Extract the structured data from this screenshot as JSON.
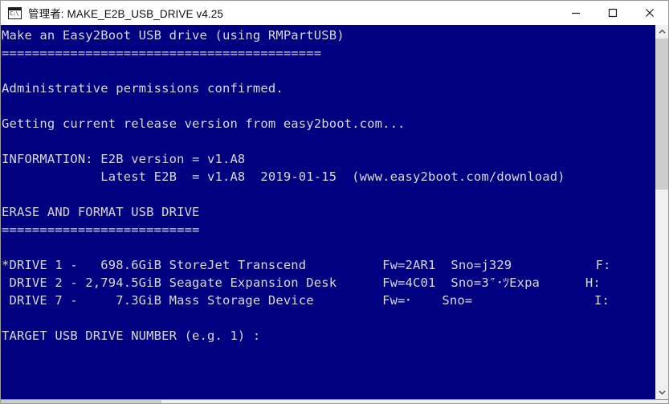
{
  "window": {
    "title": "管理者: MAKE_E2B_USB_DRIVE v4.25",
    "icon_name": "console-window-icon",
    "icon_glyph": "C:\\",
    "minimize_label": "—",
    "maximize_label": "□",
    "close_label": "✕",
    "colors": {
      "titlebar_bg": "#ffffff",
      "console_bg": "#000080",
      "console_fg": "#d8d8d8",
      "scrollbar_track": "#f0f0f0",
      "scrollbar_thumb": "#cdcdcd"
    }
  },
  "console": {
    "lines": [
      "Make an Easy2Boot USB drive (using RMPartUSB)",
      "==========================================",
      "",
      "Administrative permissions confirmed.",
      "",
      "Getting current release version from easy2boot.com...",
      "",
      "INFORMATION: E2B version = v1.A8",
      "             Latest E2B  = v1.A8  2019-01-15  (www.easy2boot.com/download)",
      "",
      "ERASE AND FORMAT USB DRIVE",
      "==========================",
      "",
      "*DRIVE 1 -   698.6GiB StoreJet Transcend          Fw=2AR1  Sno=j329           F:",
      " DRIVE 2 - 2,794.5GiB Seagate Expansion Desk      Fw=4C01  Sno=3″･ﾂExpa      H:",
      " DRIVE 7 -     7.3GiB Mass Storage Device         Fw=･    Sno=                I:",
      "",
      "TARGET USB DRIVE NUMBER (e.g. 1) :"
    ],
    "drives": [
      {
        "selected": true,
        "label": "DRIVE 1",
        "size": "698.6GiB",
        "model": "StoreJet Transcend",
        "firmware": "Fw=2AR1",
        "serial": "Sno=j329",
        "letter": "F:"
      },
      {
        "selected": false,
        "label": "DRIVE 2",
        "size": "2,794.5GiB",
        "model": "Seagate Expansion Desk",
        "firmware": "Fw=4C01",
        "serial": "Sno=3″･ﾂExpa",
        "letter": "H:"
      },
      {
        "selected": false,
        "label": "DRIVE 7",
        "size": "7.3GiB",
        "model": "Mass Storage Device",
        "firmware": "Fw=･",
        "serial": "Sno=",
        "letter": "I:"
      }
    ],
    "info": {
      "e2b_version": "v1.A8",
      "latest_e2b": "v1.A8",
      "latest_date": "2019-01-15",
      "download_url": "(www.easy2boot.com/download)"
    },
    "prompt": "TARGET USB DRIVE NUMBER (e.g. 1) :"
  },
  "scrollbar": {
    "up_arrow": "▲",
    "down_arrow": "▼"
  }
}
